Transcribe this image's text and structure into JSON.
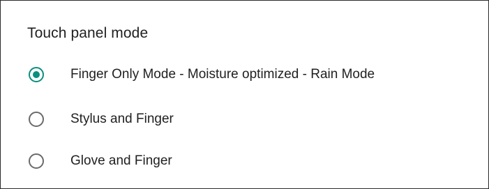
{
  "dialog": {
    "title": "Touch panel mode",
    "accent_color": "#0a8f7e",
    "options": [
      {
        "label": "Finger Only Mode - Moisture optimized - Rain Mode",
        "selected": true
      },
      {
        "label": "Stylus and Finger",
        "selected": false
      },
      {
        "label": "Glove and Finger",
        "selected": false
      }
    ]
  }
}
